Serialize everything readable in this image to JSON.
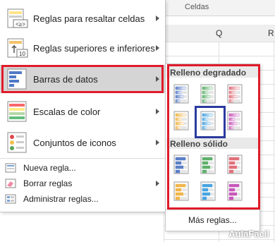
{
  "ribbon": {
    "group_label": "Celdas"
  },
  "columns": [
    {
      "label": "Q"
    },
    {
      "label": "R"
    }
  ],
  "menu": {
    "items": [
      {
        "label": "Reglas para resaltar celdas",
        "icon": "highlight-rules-icon",
        "badge": "<≥>"
      },
      {
        "label": "Reglas superiores e inferiores",
        "icon": "top-bottom-rules-icon",
        "badge": "10"
      },
      {
        "label": "Barras de datos",
        "icon": "data-bars-icon"
      },
      {
        "label": "Escalas de color",
        "icon": "color-scales-icon"
      },
      {
        "label": "Conjuntos de iconos",
        "icon": "icon-sets-icon"
      }
    ],
    "small_items": [
      {
        "label": "Nueva regla...",
        "icon": "new-rule-icon"
      },
      {
        "label": "Borrar reglas",
        "icon": "clear-rules-icon"
      },
      {
        "label": "Administrar reglas...",
        "icon": "manage-rules-icon"
      }
    ]
  },
  "submenu": {
    "gradient_title": "Relleno degradado",
    "solid_title": "Relleno sólido",
    "more_label": "Más reglas...",
    "colors": [
      "#5b7fc6",
      "#5fb06a",
      "#e0707a",
      "#f0b64a",
      "#4aa4e0",
      "#c658b8"
    ]
  },
  "watermark": "AulaFacil"
}
